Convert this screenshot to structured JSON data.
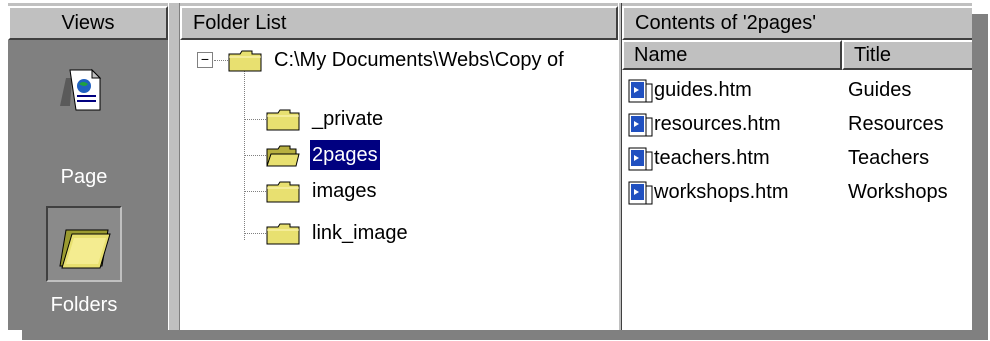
{
  "views": {
    "header": "Views",
    "items": [
      {
        "label": "Page",
        "icon": "page-icon"
      },
      {
        "label": "Folders",
        "icon": "folders-icon",
        "active": true
      }
    ]
  },
  "folder_list": {
    "header": "Folder List",
    "root": {
      "label": "C:\\My Documents\\Webs\\Copy of",
      "expander": "−"
    },
    "children": [
      {
        "label": "_private"
      },
      {
        "label": "2pages",
        "selected": true
      },
      {
        "label": "images"
      },
      {
        "label": "link_image"
      }
    ]
  },
  "contents": {
    "header": "Contents of '2pages'",
    "columns": [
      "Name",
      "Title"
    ],
    "files": [
      {
        "name": "guides.htm",
        "title": "Guides"
      },
      {
        "name": "resources.htm",
        "title": "Resources"
      },
      {
        "name": "teachers.htm",
        "title": "Teachers"
      },
      {
        "name": "workshops.htm",
        "title": "Workshops"
      }
    ]
  },
  "colors": {
    "selection": "#000080",
    "pane_bg": "#c0c0c0",
    "views_bg": "#808080",
    "folder": "#e8e070"
  }
}
